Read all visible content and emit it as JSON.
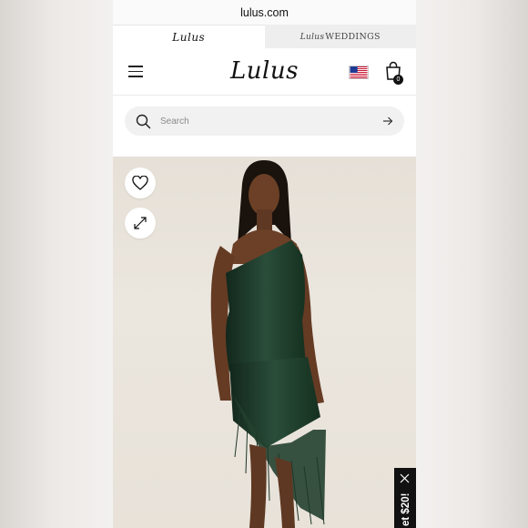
{
  "browser": {
    "url": "lulus.com"
  },
  "brand_tabs": [
    {
      "label": "Lulus"
    },
    {
      "label_a": "Lulus",
      "label_b": "WEDDINGS"
    }
  ],
  "header": {
    "logo": "Lulus",
    "cart_count": "0",
    "flag": "us-flag-icon"
  },
  "search": {
    "placeholder": "Search"
  },
  "promo": {
    "text": "et $20!"
  },
  "colors": {
    "dress": "#1f3a2c",
    "background": "#e8e2d9",
    "text": "#111111"
  }
}
